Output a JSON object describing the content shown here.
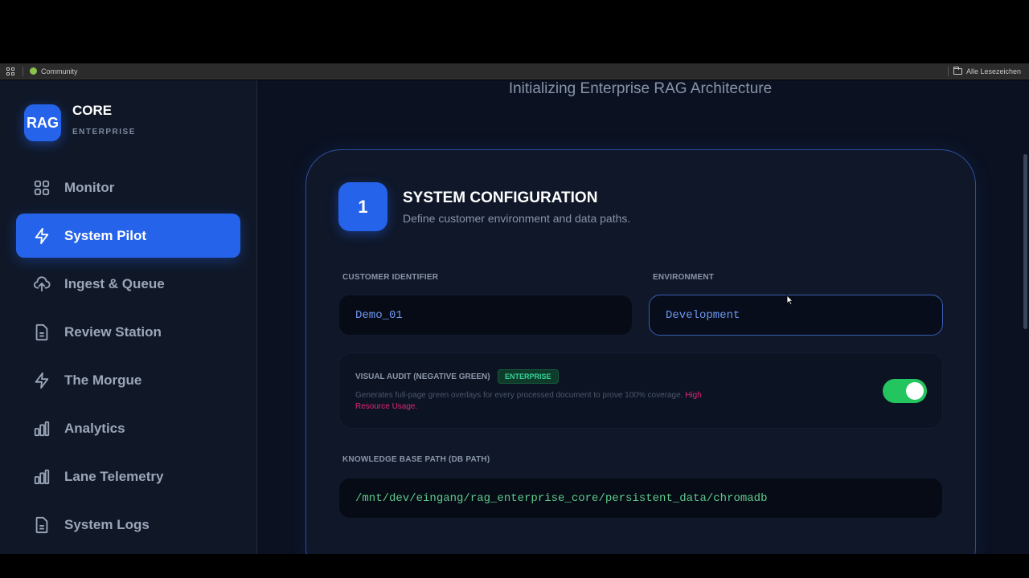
{
  "browser": {
    "bookmarks": [
      {
        "label": "Community"
      }
    ],
    "bookmarks_right": "Alle Lesezeichen"
  },
  "sidebar": {
    "logo": "RAG",
    "title": "CORE",
    "subtitle": "ENTERPRISE",
    "items": [
      {
        "label": "Monitor",
        "icon": "grid-icon",
        "active": false
      },
      {
        "label": "System Pilot",
        "icon": "lightning-icon",
        "active": true
      },
      {
        "label": "Ingest & Queue",
        "icon": "cloud-upload-icon",
        "active": false
      },
      {
        "label": "Review Station",
        "icon": "document-icon",
        "active": false
      },
      {
        "label": "The Morgue",
        "icon": "lightning-icon",
        "active": false
      },
      {
        "label": "Analytics",
        "icon": "bar-chart-icon",
        "active": false
      },
      {
        "label": "Lane Telemetry",
        "icon": "bar-chart-icon",
        "active": false
      },
      {
        "label": "System Logs",
        "icon": "document-icon",
        "active": false
      }
    ]
  },
  "main": {
    "headline": "Initializing Enterprise RAG Architecture",
    "card": {
      "step": "1",
      "title": "SYSTEM CONFIGURATION",
      "subtitle": "Define customer environment and data paths.",
      "customer_label": "CUSTOMER IDENTIFIER",
      "customer_value": "Demo_01",
      "environment_label": "ENVIRONMENT",
      "environment_value": "Development",
      "audit": {
        "title": "VISUAL AUDIT (NEGATIVE GREEN)",
        "badge": "ENTERPRISE",
        "description": "Generates full-page green overlays for every processed document to prove 100% coverage.",
        "warning": "High Resource Usage.",
        "enabled": true
      },
      "kb_label": "KNOWLEDGE BASE PATH (DB PATH)",
      "kb_value": "/mnt/dev/eingang/rag_enterprise_core/persistent_data/chromadb"
    }
  },
  "colors": {
    "accent": "#2563eb",
    "background": "#0b1120",
    "sidebar": "#101828",
    "toggle_on": "#22c55e",
    "path_text": "#5fc98a",
    "warning": "#db2777"
  }
}
